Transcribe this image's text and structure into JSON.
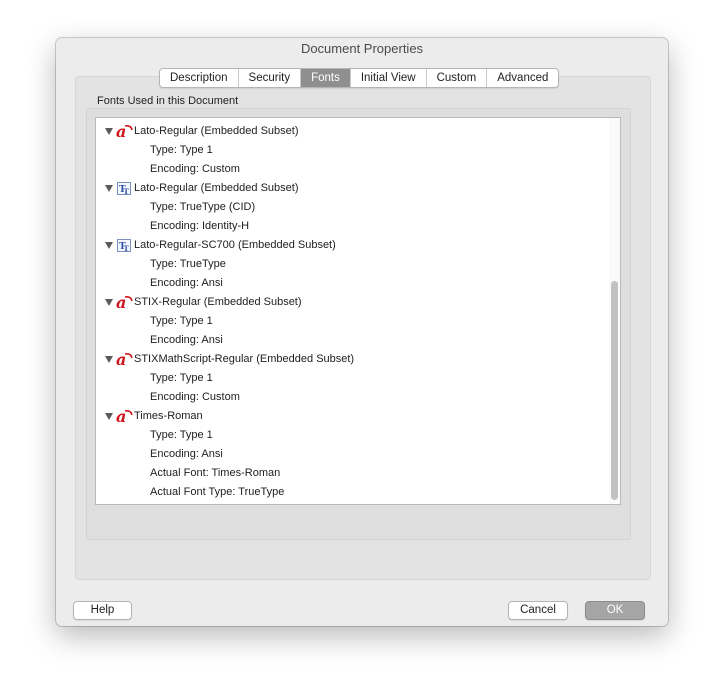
{
  "window": {
    "title": "Document Properties"
  },
  "tabs": [
    {
      "label": "Description",
      "active": false
    },
    {
      "label": "Security",
      "active": false
    },
    {
      "label": "Fonts",
      "active": true
    },
    {
      "label": "Initial View",
      "active": false
    },
    {
      "label": "Custom",
      "active": false
    },
    {
      "label": "Advanced",
      "active": false
    }
  ],
  "fonts_section": {
    "label": "Fonts Used in this Document",
    "fonts": [
      {
        "name": "Lato-Regular (Embedded Subset)",
        "icon": "type1-font-icon",
        "properties": [
          "Type: Type 1",
          "Encoding: Custom"
        ]
      },
      {
        "name": "Lato-Regular (Embedded Subset)",
        "icon": "truetype-font-icon",
        "properties": [
          "Type: TrueType (CID)",
          "Encoding: Identity-H"
        ]
      },
      {
        "name": "Lato-Regular-SC700 (Embedded Subset)",
        "icon": "truetype-font-icon",
        "properties": [
          "Type: TrueType",
          "Encoding: Ansi"
        ]
      },
      {
        "name": "STIX-Regular (Embedded Subset)",
        "icon": "type1-font-icon",
        "properties": [
          "Type: Type 1",
          "Encoding: Ansi"
        ]
      },
      {
        "name": "STIXMathScript-Regular (Embedded Subset)",
        "icon": "type1-font-icon",
        "properties": [
          "Type: Type 1",
          "Encoding: Custom"
        ]
      },
      {
        "name": "Times-Roman",
        "icon": "type1-font-icon",
        "properties": [
          "Type: Type 1",
          "Encoding: Ansi",
          "Actual Font: Times-Roman",
          "Actual Font Type: TrueType"
        ]
      }
    ]
  },
  "buttons": {
    "help": "Help",
    "cancel": "Cancel",
    "ok": "OK"
  },
  "colors": {
    "type1_icon": "#d0141c",
    "truetype_icon": "#2c4fa8",
    "active_tab": "#8f8f8f"
  }
}
